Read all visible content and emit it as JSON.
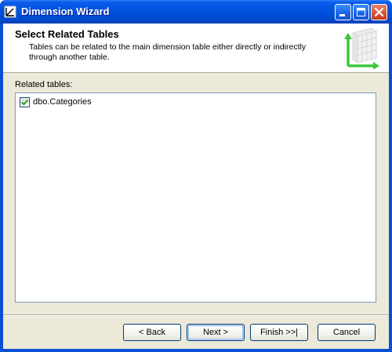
{
  "window": {
    "title": "Dimension Wizard"
  },
  "header": {
    "title": "Select Related Tables",
    "description": "Tables can be related to the main dimension table either directly or indirectly through another table."
  },
  "related": {
    "label": "Related tables:",
    "items": [
      {
        "name": "dbo.Categories",
        "checked": true
      }
    ]
  },
  "buttons": {
    "back": "< Back",
    "next": "Next >",
    "finish": "Finish >>|",
    "cancel": "Cancel"
  },
  "icons": {
    "app": "dimension-wizard-icon",
    "header": "dimension-table-icon",
    "minimize": "minimize-icon",
    "maximize": "maximize-icon",
    "close": "close-icon",
    "check": "checkmark-icon"
  },
  "colors": {
    "titlebar": "#0051dd",
    "client": "#ece9d8",
    "checkmark": "#21a121",
    "header_arrow": "#3dc63d"
  }
}
